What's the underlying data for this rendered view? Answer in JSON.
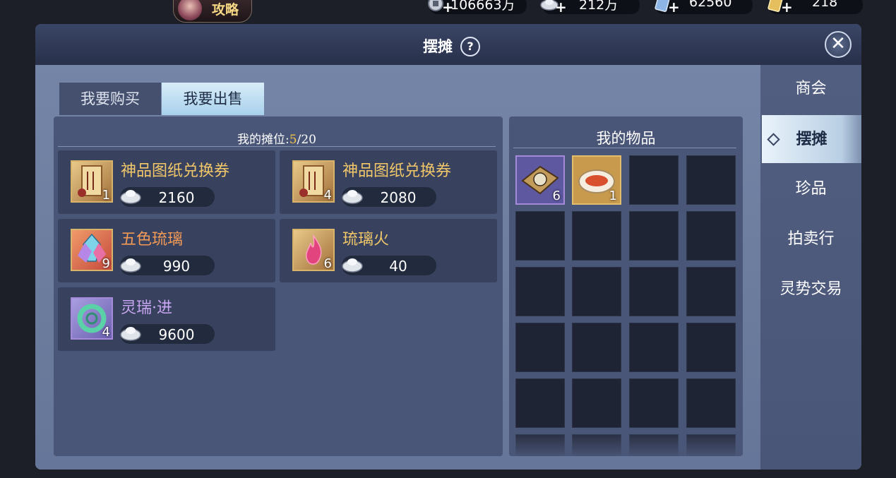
{
  "top_bar": {
    "guide_label": "攻略",
    "currencies": [
      {
        "icon": "copper-coin-icon",
        "value": "106663万"
      },
      {
        "icon": "silver-ingot-icon",
        "value": "212万"
      },
      {
        "icon": "jade-ticket-icon",
        "value": "62560"
      },
      {
        "icon": "gold-ticket-icon",
        "value": "218"
      }
    ]
  },
  "panel": {
    "title": "摆摊",
    "help": "?",
    "close": "✕"
  },
  "tabs": {
    "buy": "我要购买",
    "sell": "我要出售"
  },
  "stall": {
    "label_prefix": "我的摊位:",
    "used": "5",
    "capacity": "/20",
    "items": [
      {
        "name": "神品图纸兑换券",
        "count": "1",
        "price": "2160",
        "name_color": "#f2c76a",
        "icon": "scroll-icon"
      },
      {
        "name": "神品图纸兑换券",
        "count": "4",
        "price": "2080",
        "name_color": "#f2c76a",
        "icon": "scroll-icon"
      },
      {
        "name": "五色琉璃",
        "count": "9",
        "price": "990",
        "name_color": "#f39a56",
        "icon": "crystal-icon"
      },
      {
        "name": "琉璃火",
        "count": "6",
        "price": "40",
        "name_color": "#f2c76a",
        "icon": "flame-icon"
      },
      {
        "name": "灵瑞·进",
        "count": "4",
        "price": "9600",
        "name_color": "#c9a7f2",
        "icon": "jade-ring-icon"
      }
    ]
  },
  "inventory": {
    "title": "我的物品",
    "items": [
      {
        "icon": "plate-icon",
        "count": "6"
      },
      {
        "icon": "fish-dish-icon",
        "count": "1"
      }
    ]
  },
  "sidebar": {
    "items": [
      "商会",
      "摆摊",
      "珍品",
      "拍卖行",
      "灵势交易"
    ],
    "active_index": 1
  }
}
